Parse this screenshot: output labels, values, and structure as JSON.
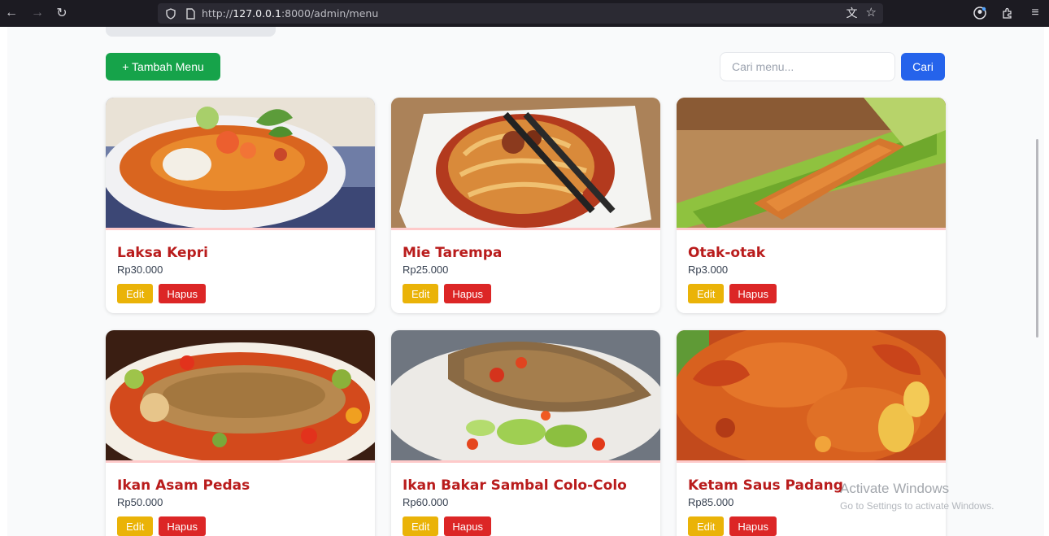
{
  "browser": {
    "url_prefix": "http://",
    "url_host": "127.0.0.1",
    "url_path": ":8000/admin/menu"
  },
  "toolbar": {
    "add_label": "+ Tambah Menu",
    "search_placeholder": "Cari menu...",
    "search_button": "Cari"
  },
  "menu": [
    {
      "name": "Laksa Kepri",
      "price": "Rp30.000",
      "edit": "Edit",
      "delete": "Hapus"
    },
    {
      "name": "Mie Tarempa",
      "price": "Rp25.000",
      "edit": "Edit",
      "delete": "Hapus"
    },
    {
      "name": "Otak-otak",
      "price": "Rp3.000",
      "edit": "Edit",
      "delete": "Hapus"
    },
    {
      "name": "Ikan Asam Pedas",
      "price": "Rp50.000",
      "edit": "Edit",
      "delete": "Hapus"
    },
    {
      "name": "Ikan Bakar Sambal Colo-Colo",
      "price": "Rp60.000",
      "edit": "Edit",
      "delete": "Hapus"
    },
    {
      "name": "Ketam Saus Padang",
      "price": "Rp85.000",
      "edit": "Edit",
      "delete": "Hapus"
    }
  ],
  "watermark": {
    "title": "Activate Windows",
    "subtitle": "Go to Settings to activate Windows."
  },
  "colors": {
    "primary_green": "#16a34a",
    "search_blue": "#2563eb",
    "title_red": "#b91c1c",
    "edit_yellow": "#eab308",
    "delete_red": "#dc2626"
  }
}
